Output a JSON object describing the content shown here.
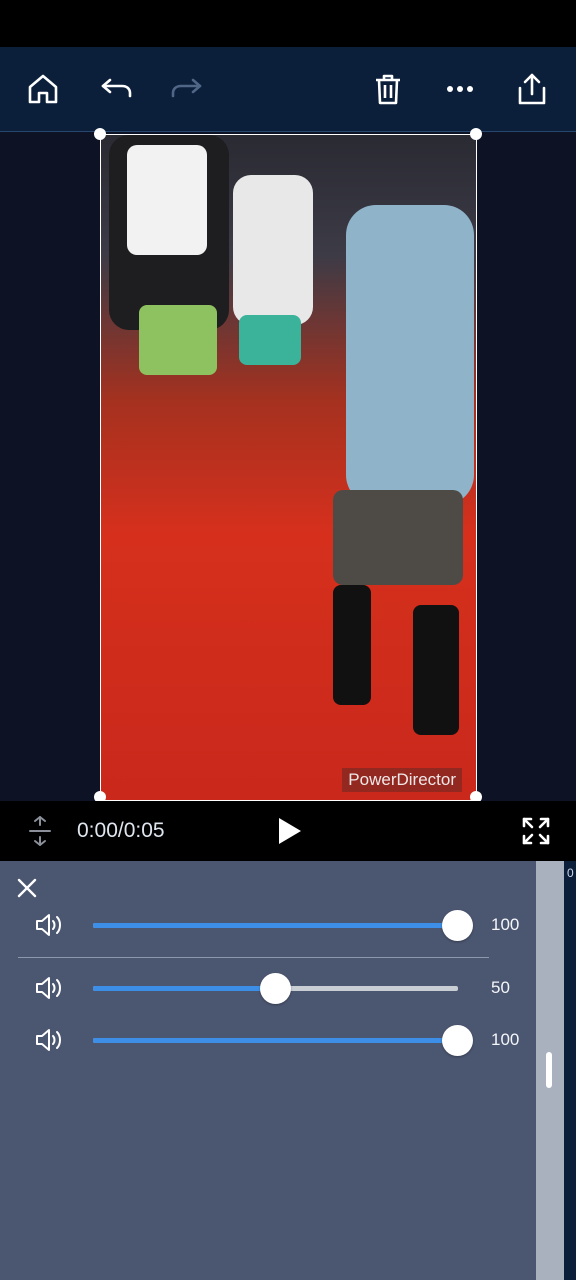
{
  "toolbar": {
    "home_icon": "home-icon",
    "undo_icon": "undo-icon",
    "redo_icon": "redo-icon",
    "delete_icon": "trash-icon",
    "more_icon": "more-icon",
    "share_icon": "share-icon"
  },
  "preview": {
    "watermark": "PowerDirector"
  },
  "playback": {
    "time": "0:00/0:05"
  },
  "volume_panel": {
    "tracks": [
      {
        "value_label": "100",
        "level": 1.0
      },
      {
        "value_label": "50",
        "level": 0.5
      },
      {
        "value_label": "100",
        "level": 1.0
      }
    ]
  },
  "timeline_edge_label": "0",
  "colors": {
    "toolbar_bg": "#0b1e3a",
    "panel_bg": "#4b5670",
    "slider_fill": "#3d8ee6",
    "slider_track": "#c9cdd4"
  }
}
